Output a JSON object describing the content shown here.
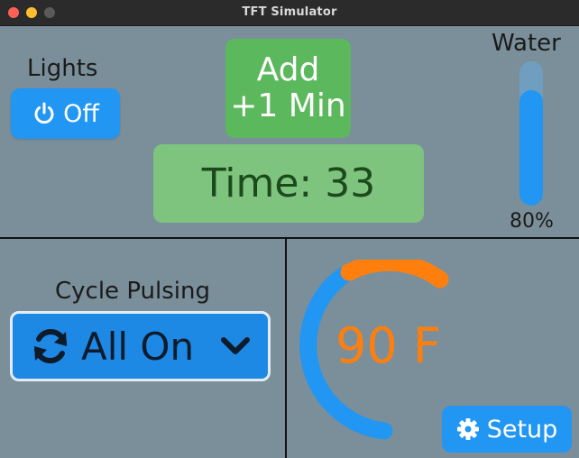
{
  "window": {
    "title": "TFT Simulator"
  },
  "lights": {
    "label": "Lights",
    "button_label": "Off",
    "icon": "power-icon"
  },
  "add_button": {
    "line1": "Add",
    "line2": "+1 Min"
  },
  "time": {
    "text": "Time: 33"
  },
  "water": {
    "label": "Water",
    "percent_text": "80%",
    "level": 0.8
  },
  "cycle": {
    "label": "Cycle Pulsing",
    "selected": "All On",
    "icon": "refresh-icon",
    "caret_icon": "chevron-down-icon"
  },
  "temperature": {
    "value_text": "90 F",
    "arc_color": "#ff7f0e",
    "track_color": "#2196f3"
  },
  "setup": {
    "label": "Setup",
    "icon": "gear-icon"
  },
  "colors": {
    "primary": "#2196f3",
    "success": "#5cb85c",
    "accent": "#ff7f0e",
    "background": "#7b8f9a"
  }
}
